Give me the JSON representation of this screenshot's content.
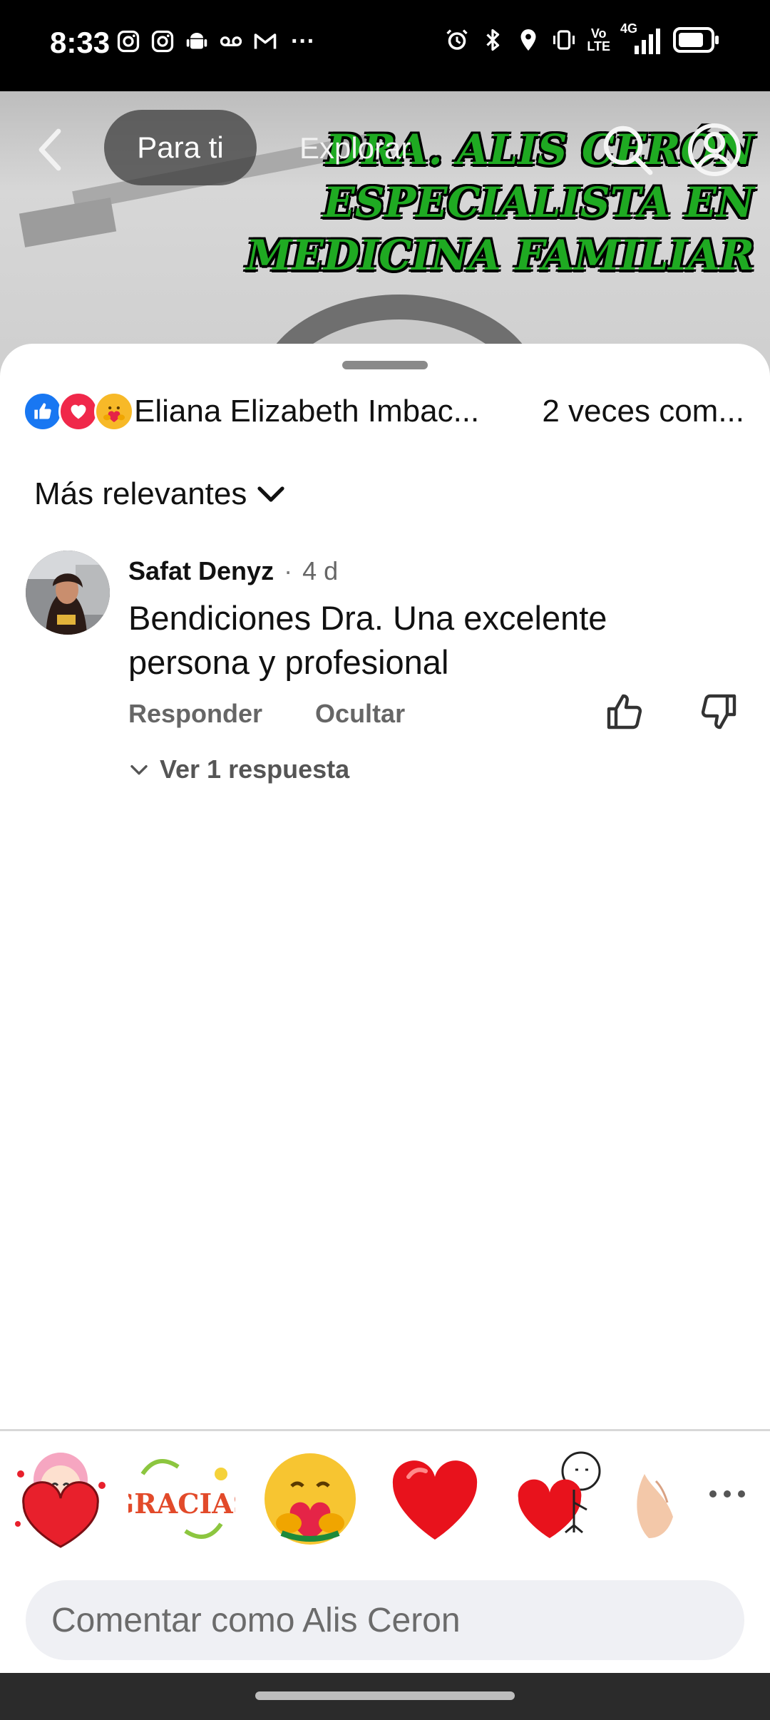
{
  "status_bar": {
    "time": "8:33",
    "more_indicator": "···",
    "network_label_top": "Vo",
    "network_label_bottom": "LTE",
    "network_type": "4G"
  },
  "top_nav": {
    "tab_active": "Para ti",
    "tab_inactive": "Explorar"
  },
  "video": {
    "overlay_lines": [
      "DRA. ALIS CERÓN",
      "ESPECIALISTA EN",
      "MEDICINA FAMILIAR"
    ],
    "overlay_color": "#1faa22"
  },
  "reactions": {
    "icons": [
      "like-icon",
      "love-icon",
      "care-icon"
    ],
    "reactors_text": "Eliana Elizabeth Imbac...",
    "shares_text": "2 veces com..."
  },
  "sort": {
    "label": "Más relevantes"
  },
  "comments": [
    {
      "author": "Safat Denyz",
      "separator": "·",
      "time": "4 d",
      "text": "Bendiciones Dra. Una excelente persona y profesional",
      "reply_label": "Responder",
      "hide_label": "Ocultar",
      "view_replies": "Ver 1 respuesta"
    }
  ],
  "stickers": [
    "girl-heart-sticker",
    "gracias-sticker",
    "care-emoji-sticker",
    "red-heart-sticker",
    "man-heart-sticker",
    "hands-sticker"
  ],
  "sticker_word": "GRACIAS",
  "comment_input": {
    "placeholder": "Comentar como Alis Ceron"
  },
  "colors": {
    "like_blue": "#1877f2",
    "love_red": "#f0284a",
    "care_yellow": "#f7b928",
    "input_bg": "#eff0f4"
  }
}
